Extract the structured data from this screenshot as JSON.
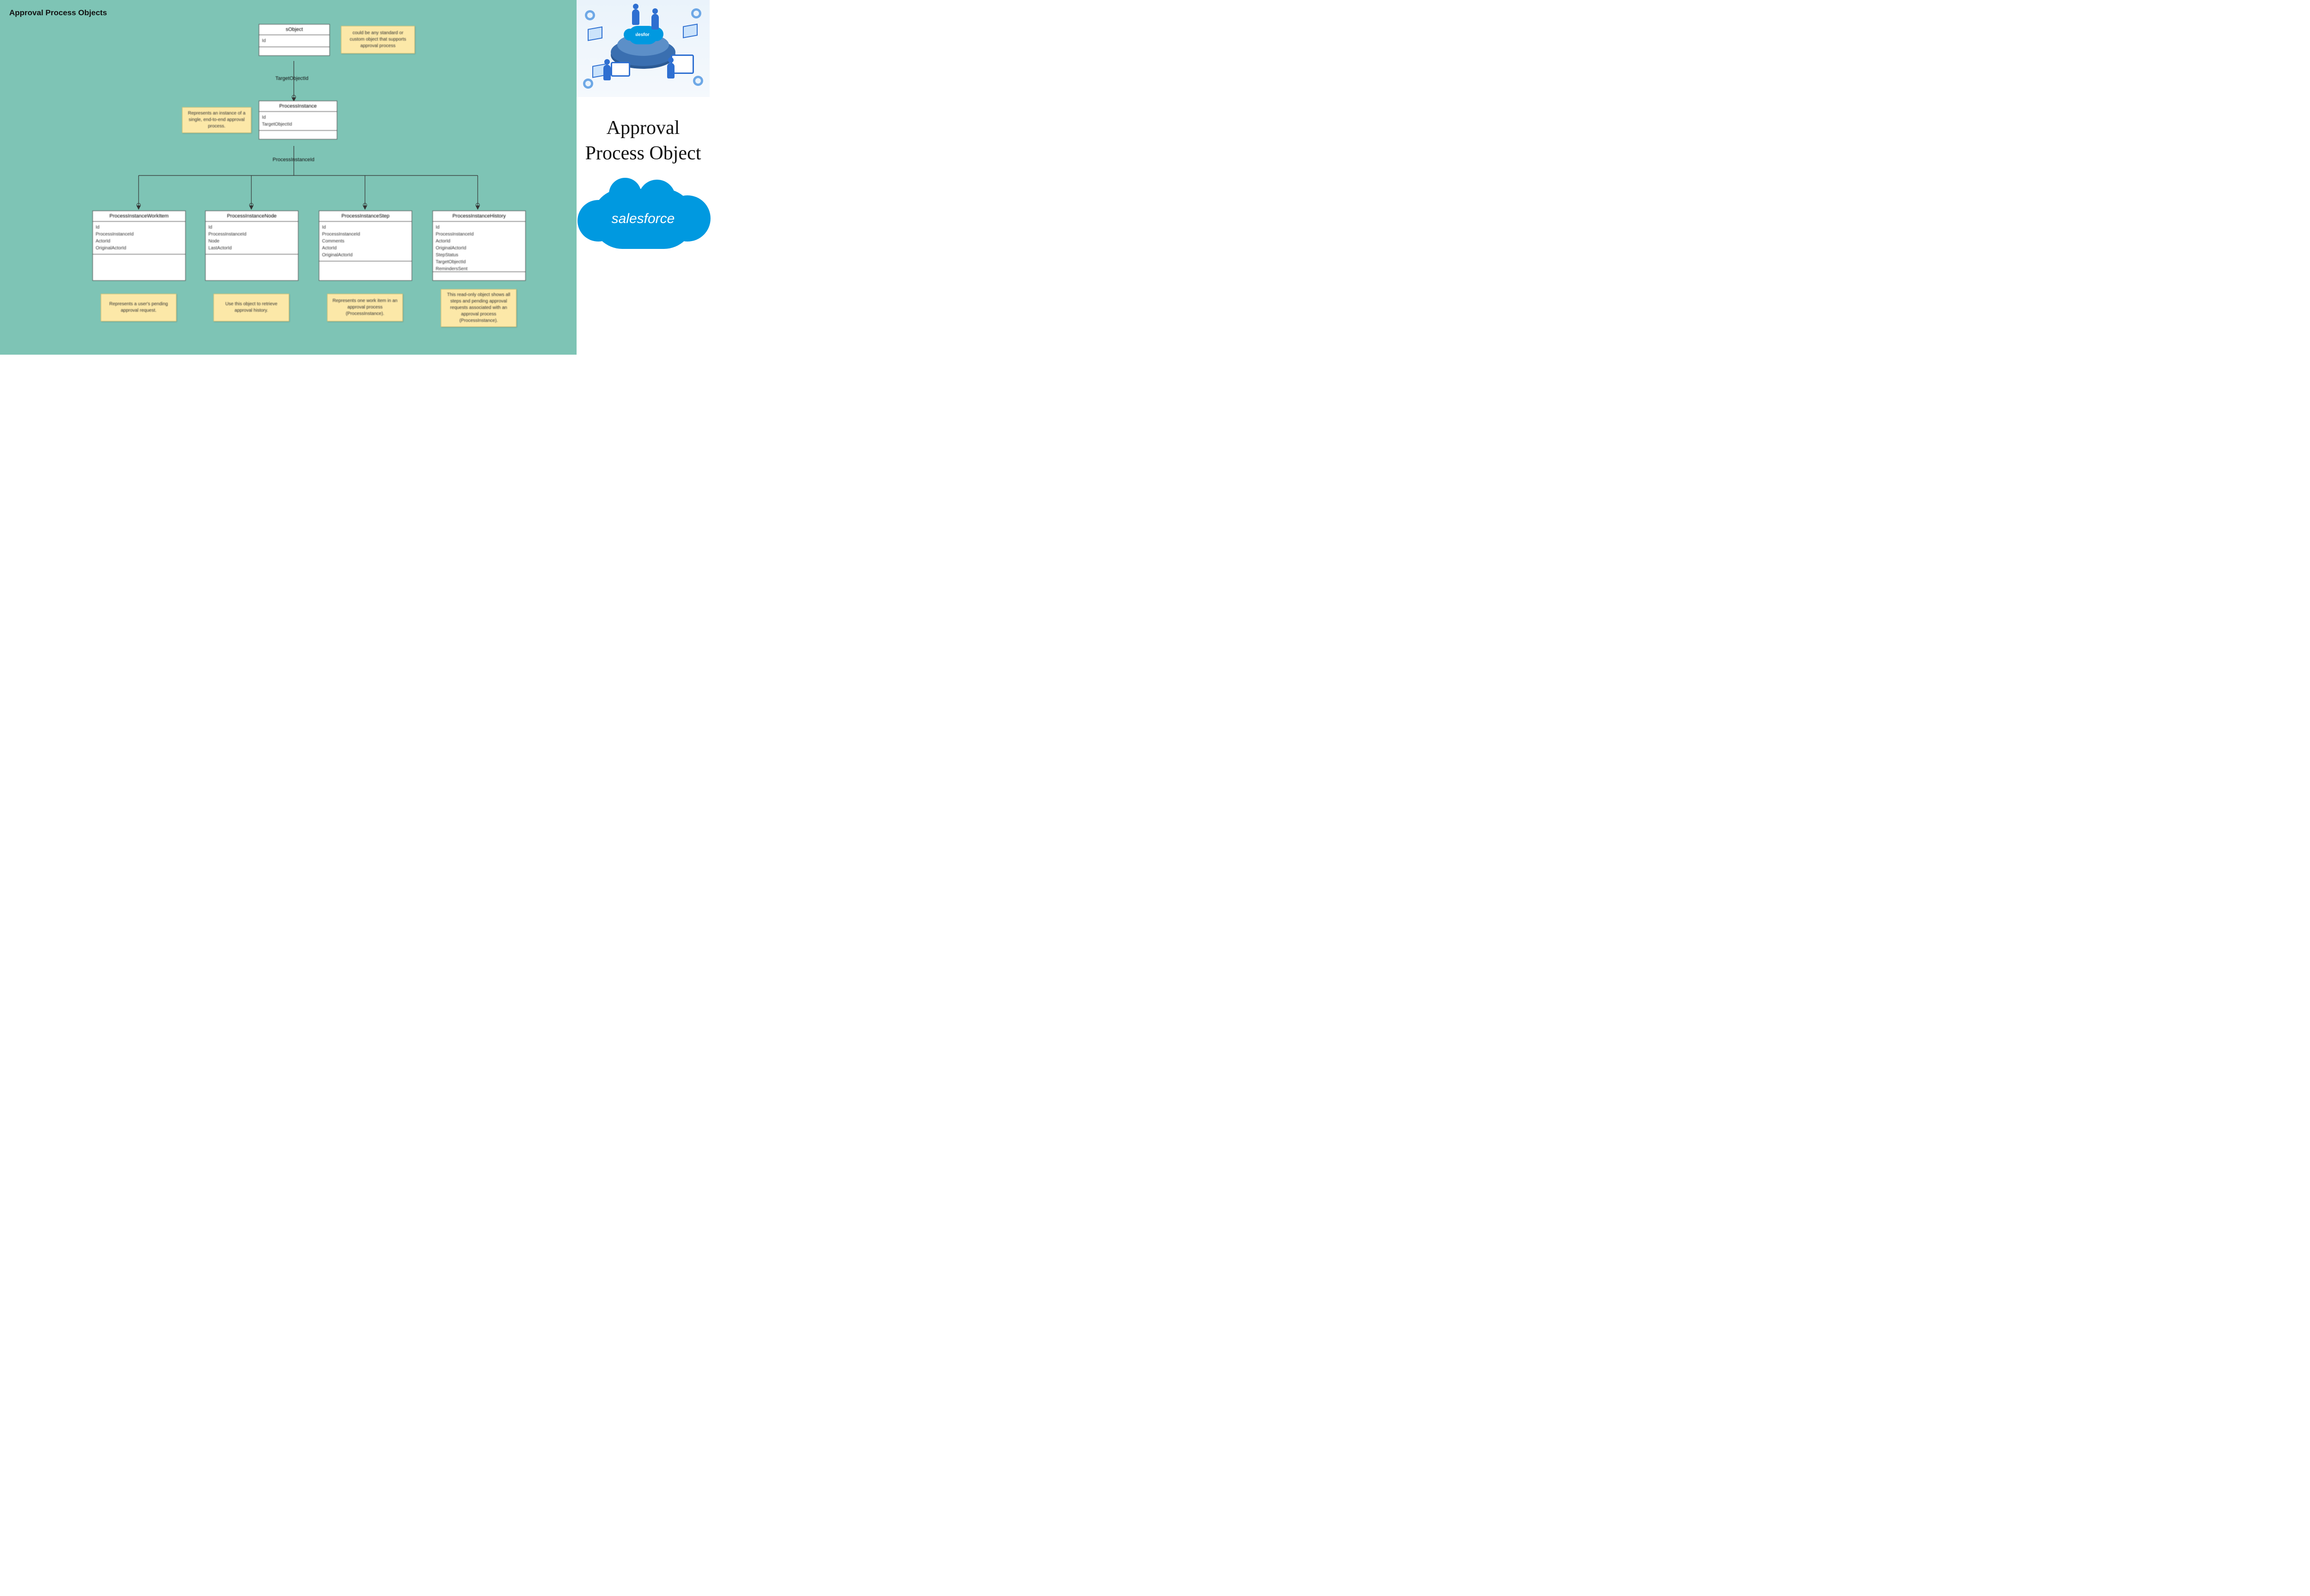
{
  "diagram": {
    "title": "Approval Process Objects",
    "edges": {
      "e1": "TargetObjectId",
      "e2": "ProcessInstanceId"
    },
    "nodes": {
      "sobject": {
        "title": "sObject",
        "fields": "Id"
      },
      "processInstance": {
        "title": "ProcessInstance",
        "fields": "Id\nTargetObjectId"
      },
      "workItem": {
        "title": "ProcessInstanceWorkItem",
        "fields": "Id\nProcessInstanceId\nActorId\nOriginalActorId"
      },
      "node": {
        "title": "ProcessInstanceNode",
        "fields": "Id\nProcessInstanceId\nNode\nLastActorId"
      },
      "step": {
        "title": "ProcessInstanceStep",
        "fields": "Id\nProcessInstanceId\nComments\nActorId\nOriginalActorId"
      },
      "history": {
        "title": "ProcessInstanceHistory",
        "fields": "Id\nProcessInstanceId\nActorId\nOriginalActorId\nStepStatus\nTargetObjectId\nRemindersSent"
      }
    },
    "notes": {
      "n1": "could be any standard or custom object that supports approval process",
      "n2": "Represents an instance of a single, end-to-end approval process.",
      "n3": "Represents a user's pending approval request.",
      "n4": "Use this object to retrieve approval history.",
      "n5": "Represents one work item in an approval process (ProcessInstance).",
      "n6": "This read-only object shows all steps and pending approval requests associated with an approval process (ProcessInstance)."
    }
  },
  "sidebar": {
    "title": "Approval Process Object",
    "brand": "salesforce"
  }
}
